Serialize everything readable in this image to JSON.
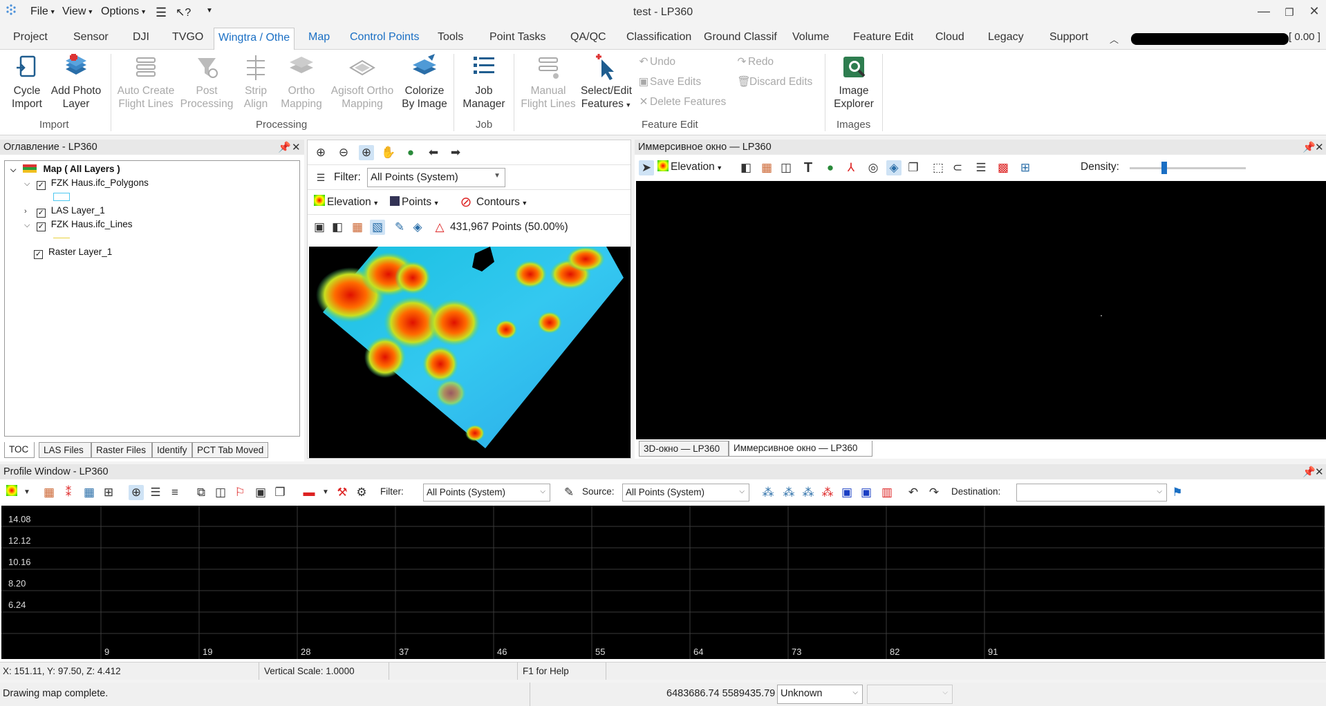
{
  "titlebar": {
    "menus": [
      "File",
      "View",
      "Options"
    ],
    "title": "test - LP360",
    "window_buttons": [
      "minimize-icon",
      "restore-icon",
      "close-icon"
    ]
  },
  "ribbon_tabs": [
    "Project",
    "Sensor",
    "DJI",
    "TVGO",
    "Wingtra / Othe",
    "Map",
    "Control Points",
    "Tools",
    "Point Tasks",
    "QA/QC",
    "Classification",
    "Ground Classif",
    "Volume",
    "Feature Edit",
    "Cloud",
    "Legacy",
    "Support"
  ],
  "active_tab": "Wingtra / Othe",
  "account_suffix": "[ 0.00 ]",
  "ribbon": {
    "import": {
      "label": "Import",
      "cycle_import": "Cycle\nImport",
      "add_photo_layer": "Add Photo\nLayer"
    },
    "processing": {
      "label": "Processing",
      "auto_create": "Auto Create\nFlight Lines",
      "post_processing": "Post\nProcessing",
      "strip_align": "Strip\nAlign",
      "ortho_mapping": "Ortho\nMapping",
      "agisoft": "Agisoft Ortho\nMapping",
      "colorize": "Colorize\nBy Image"
    },
    "job": {
      "label": "Job",
      "job_manager": "Job\nManager"
    },
    "feature_edit": {
      "label": "Feature Edit",
      "manual_flight_lines": "Manual\nFlight Lines",
      "select_edit": "Select/Edit\nFeatures",
      "undo": "Undo",
      "redo": "Redo",
      "save_edits": "Save Edits",
      "discard_edits": "Discard Edits",
      "delete_features": "Delete Features"
    },
    "images": {
      "label": "Images",
      "image_explorer": "Image\nExplorer"
    }
  },
  "toc": {
    "title": "Оглавление - LP360",
    "items": [
      {
        "label": "Map ( All Layers )",
        "bold": true
      },
      {
        "label": "FZK Haus.ifc_Polygons"
      },
      {
        "label": "LAS Layer_1"
      },
      {
        "label": "FZK Haus.ifc_Lines"
      },
      {
        "label": "Raster Layer_1"
      }
    ],
    "bottom_tabs": [
      "TOC",
      "LAS Files",
      "Raster Files",
      "Identify",
      "PCT Tab Moved"
    ]
  },
  "map": {
    "filter_label": "Filter:",
    "filter_value": "All Points (System)",
    "elevation": "Elevation",
    "points": "Points",
    "contours": "Contours",
    "points_count": "431,967 Points (50.00%)"
  },
  "immersive": {
    "title": "Иммерсивное окно — LP360",
    "elevation": "Elevation",
    "density_label": "Density:",
    "density_level": 0.3,
    "tabs": [
      "3D-окно — LP360",
      "Иммерсивное окно — LP360"
    ]
  },
  "profile": {
    "title": "Profile Window - LP360",
    "filter_label": "Filter:",
    "filter_value": "All Points (System)",
    "source_label": "Source:",
    "source_value": "All Points (System)",
    "destination_label": "Destination:",
    "destination_value": "",
    "y_ticks": [
      "14.08",
      "12.12",
      "10.16",
      "8.20",
      "6.24"
    ],
    "x_ticks": [
      "9",
      "19",
      "28",
      "37",
      "46",
      "55",
      "64",
      "73",
      "82",
      "91"
    ]
  },
  "status": {
    "coords": "X: 151.11, Y: 97.50, Z: 4.412",
    "vertical_scale": "Vertical Scale: 1.0000",
    "help": "F1 for Help",
    "message": "Drawing map complete.",
    "map_coords": "6483686.74 5589435.79",
    "units": "Unknown",
    "units2": ""
  }
}
